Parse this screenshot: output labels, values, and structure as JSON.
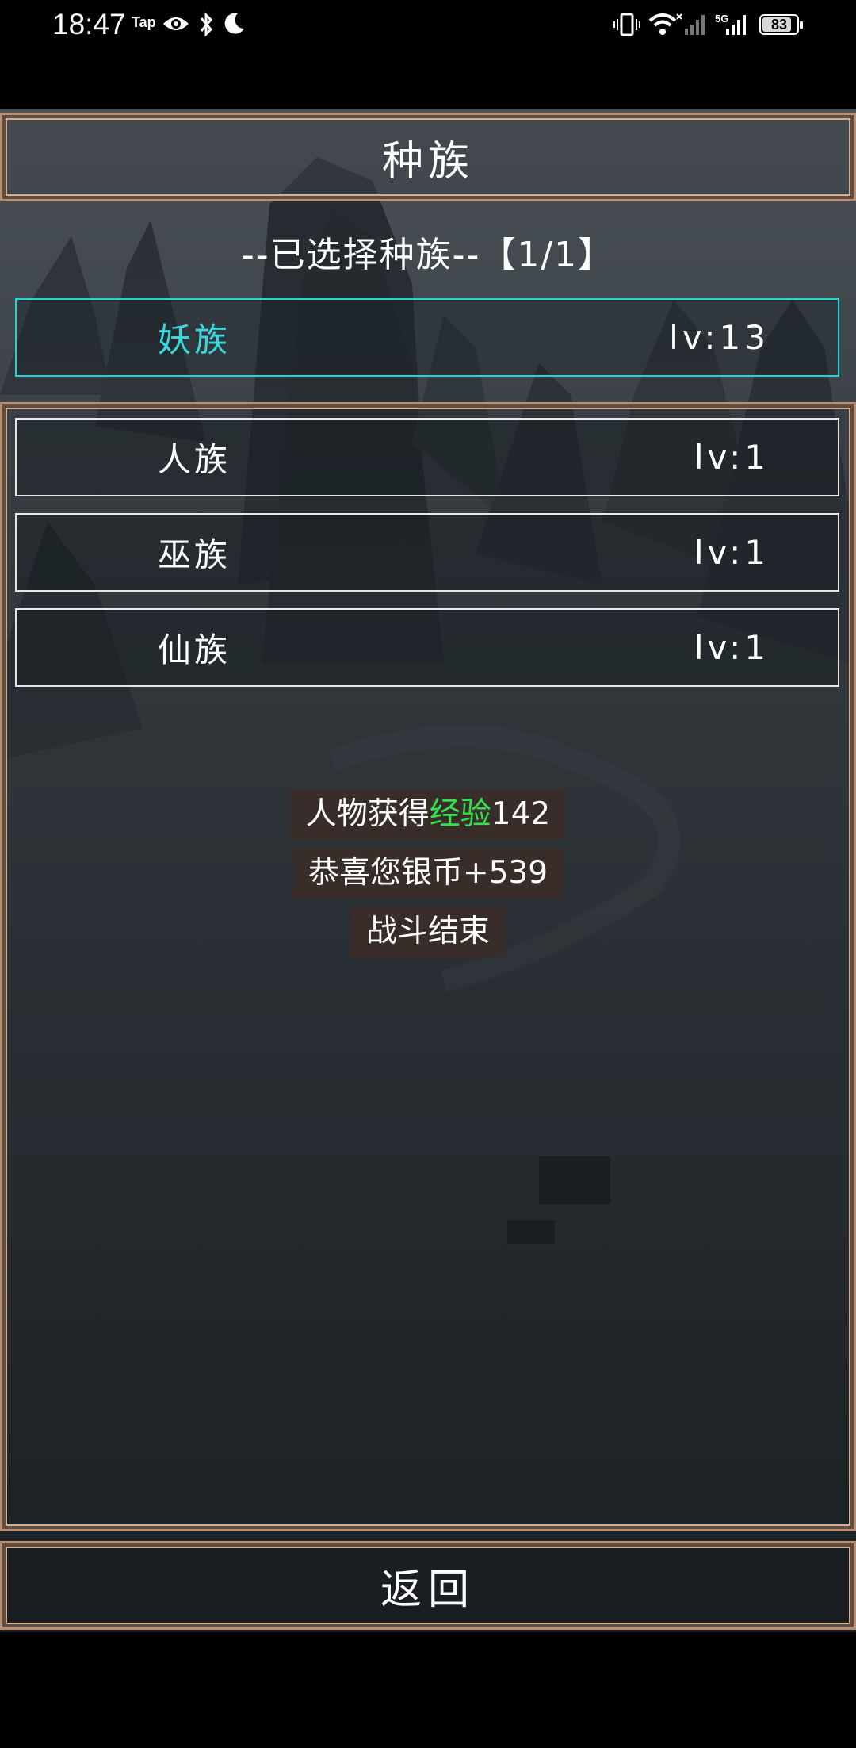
{
  "status_bar": {
    "time": "18:47",
    "tap_label": "Tap",
    "battery": "83",
    "signal_label": "5G"
  },
  "header": {
    "title": "种族"
  },
  "selected_section": {
    "heading": "--已选择种族--【1/1】",
    "race": {
      "name": "妖族",
      "level": "lv:13"
    }
  },
  "race_list": [
    {
      "name": "人族",
      "level": "lv:1"
    },
    {
      "name": "巫族",
      "level": "lv:1"
    },
    {
      "name": "仙族",
      "level": "lv:1"
    }
  ],
  "messages": {
    "exp_prefix": "人物获得",
    "exp_highlight": "经验",
    "exp_value": "142",
    "silver": "恭喜您银币+539",
    "battle_end": "战斗结束"
  },
  "footer": {
    "back_label": "返回"
  },
  "colors": {
    "frame": "#b88f73",
    "selected_border": "#22d3d8",
    "selected_text": "#39d7de",
    "highlight_green": "#33e04a"
  }
}
